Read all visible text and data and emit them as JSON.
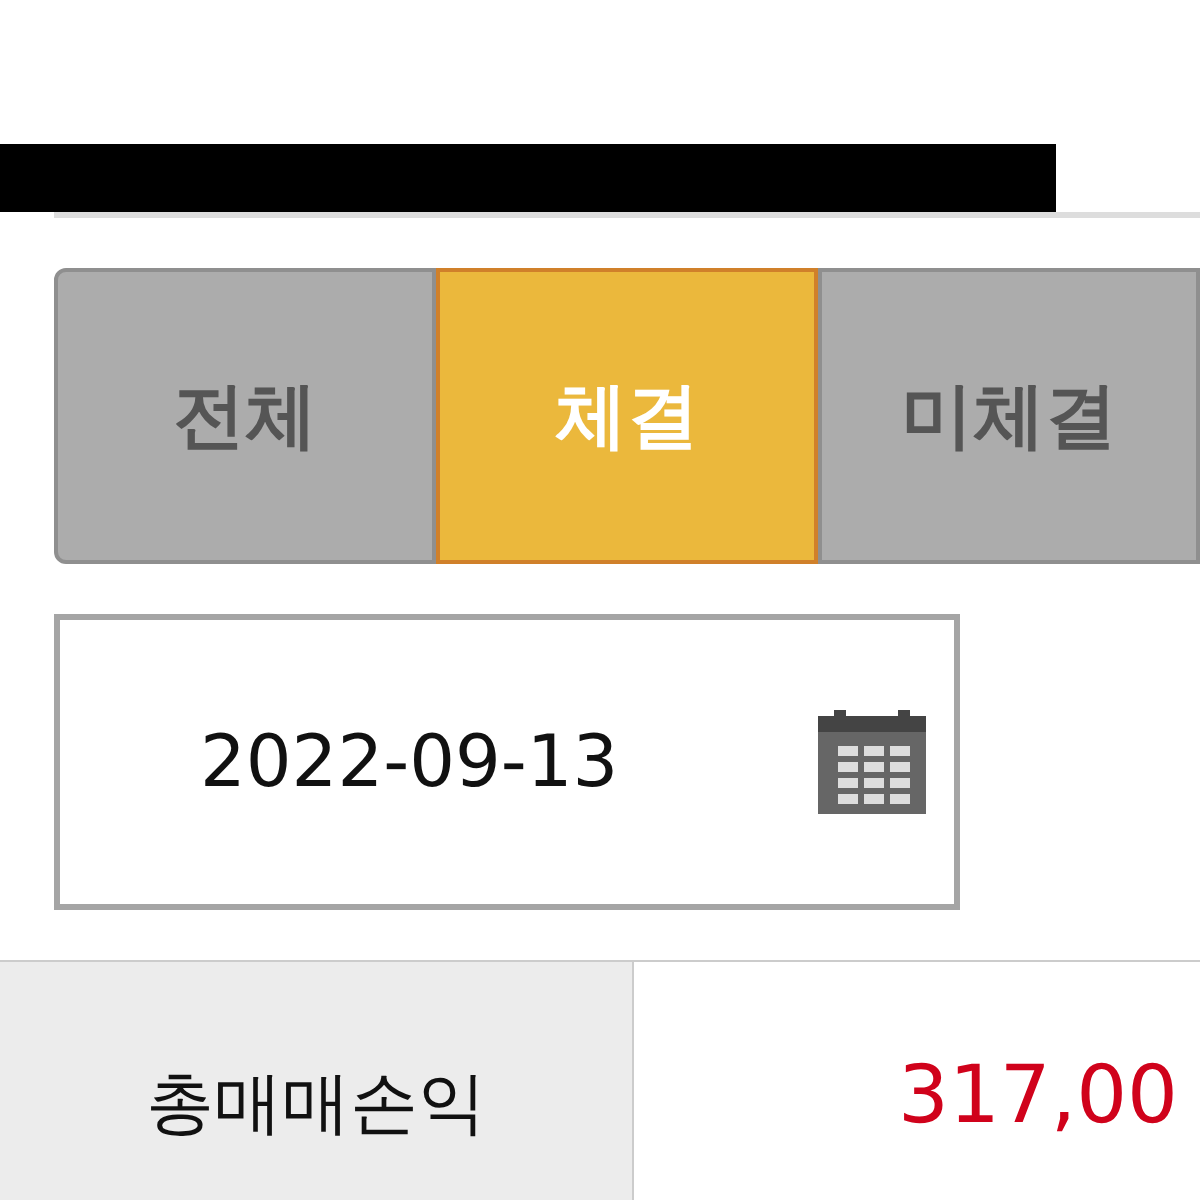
{
  "tabs": [
    {
      "label": "전체",
      "selected": false
    },
    {
      "label": "체결",
      "selected": true
    },
    {
      "label": "미체결",
      "selected": false
    }
  ],
  "date_field": {
    "value": "2022-09-13"
  },
  "summary": {
    "label": "총매매손익",
    "value": "317,00"
  }
}
